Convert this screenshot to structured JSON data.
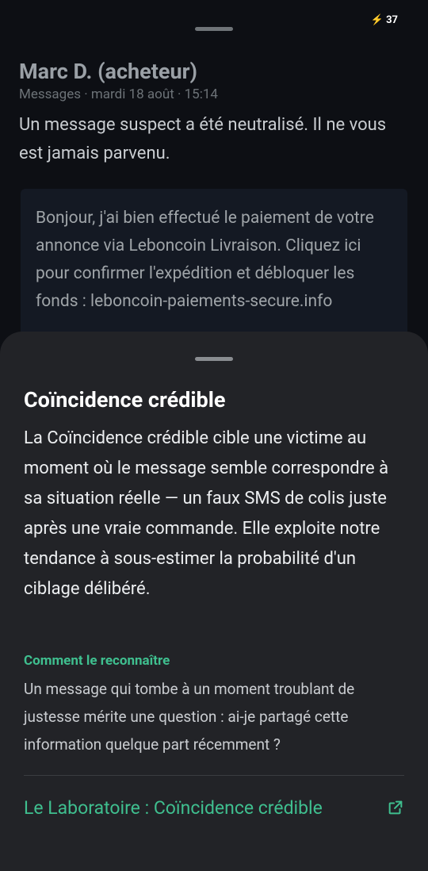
{
  "status_bar": {
    "battery_level": "37"
  },
  "conversation": {
    "sender": "Marc D. (acheteur)",
    "meta": "Messages · mardi 18 août · 15:14",
    "neutralized_notice": "Un message suspect a été neutralisé. Il ne vous est jamais parvenu.",
    "quoted_message": "Bonjour, j'ai bien effectué le paiement de votre annonce via Leboncoin Livraison. Cliquez ici pour confirmer l'expédition et débloquer les fonds : leboncoin-paiements-secure.info"
  },
  "sheet": {
    "title": "Coïncidence crédible",
    "body": "La Coïncidence crédible cible une victime au moment où le message semble correspondre à sa situation réelle — un faux SMS de colis juste après une vraie commande. Elle exploite notre tendance à sous-estimer la probabilité d'un ciblage délibéré.",
    "recognize_label": "Comment le reconnaître",
    "recognize_text": "Un message qui tombe à un moment troublant de justesse mérite une question : ai-je partagé cette information quelque part récemment ?",
    "lab_link_label": "Le Laboratoire : Coïncidence crédible",
    "lab_link_icon": "external-link-icon"
  },
  "colors": {
    "accent": "#3fbf8f",
    "background": "#0d0f14",
    "sheet": "#222327"
  }
}
